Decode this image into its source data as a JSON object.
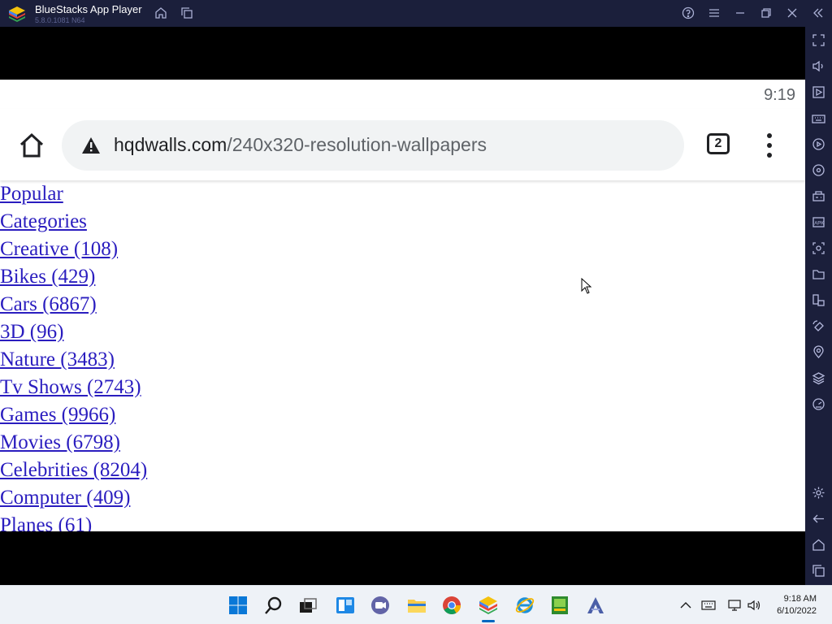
{
  "titlebar": {
    "app_name": "BlueStacks App Player",
    "version": "5.8.0.1081 N64"
  },
  "statusbar": {
    "time": "9:19"
  },
  "browser": {
    "url_domain": "hqdwalls.com",
    "url_path": "/240x320-resolution-wallpapers",
    "tab_count": "2"
  },
  "links": [
    "Popular",
    "Categories",
    "Creative (108)",
    "Bikes (429)",
    "Cars (6867)",
    "3D (96)",
    "Nature (3483)",
    "Tv Shows (2743)",
    "Games (9966)",
    "Movies (6798)",
    "Celebrities (8204)",
    "Computer (409)",
    "Planes (61)"
  ],
  "taskbar": {
    "time": "9:18 AM",
    "date": "6/10/2022"
  },
  "colors": {
    "bluestacks_chrome": "#1b1f3b",
    "link": "#2a1dbf",
    "taskbar": "#eef2f7"
  }
}
